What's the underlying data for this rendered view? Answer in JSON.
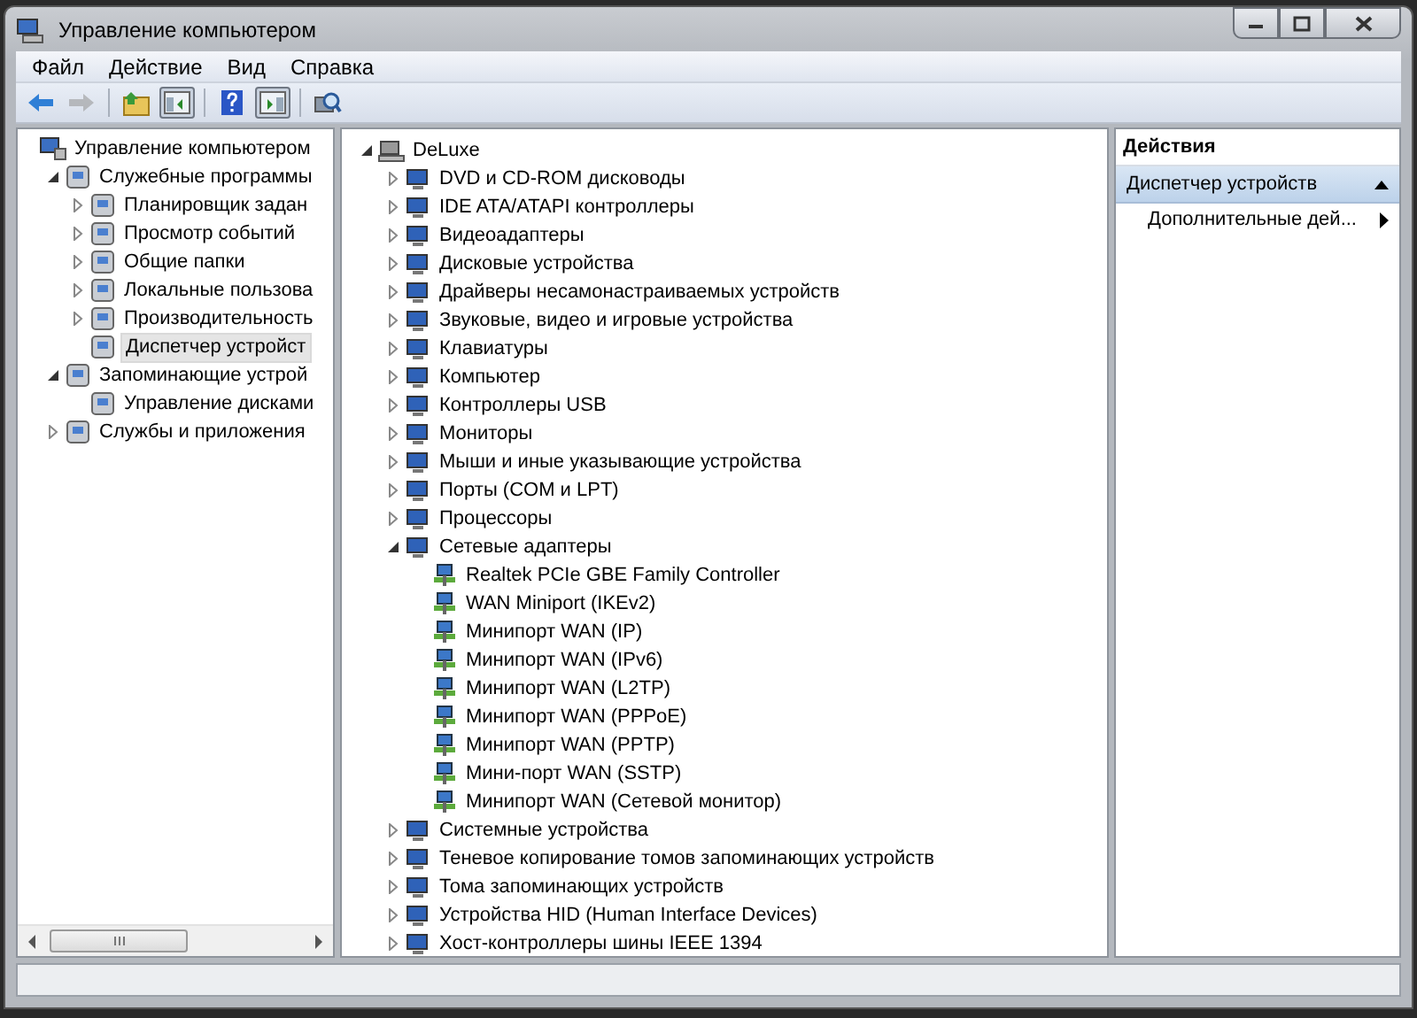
{
  "window": {
    "title": "Управление компьютером"
  },
  "menu": [
    "Файл",
    "Действие",
    "Вид",
    "Справка"
  ],
  "toolbar": [
    {
      "kind": "back",
      "disabled": false,
      "pressed": false
    },
    {
      "kind": "forward",
      "disabled": true,
      "pressed": false
    },
    {
      "kind": "sep"
    },
    {
      "kind": "up",
      "disabled": false,
      "pressed": false
    },
    {
      "kind": "tree",
      "disabled": false,
      "pressed": true
    },
    {
      "kind": "sep"
    },
    {
      "kind": "help",
      "disabled": false,
      "pressed": false
    },
    {
      "kind": "pane",
      "disabled": false,
      "pressed": true
    },
    {
      "kind": "sep"
    },
    {
      "kind": "scan",
      "disabled": false,
      "pressed": false
    }
  ],
  "left_tree": [
    {
      "label": "Управление компьютером",
      "kind": "root",
      "selected": false,
      "children": [
        {
          "label": "Служебные программы",
          "kind": "branch",
          "expanded": true,
          "selected": false,
          "children": [
            {
              "label": "Планировщик задан",
              "kind": "branch",
              "expanded": false,
              "selected": false
            },
            {
              "label": "Просмотр событий",
              "kind": "branch",
              "expanded": false,
              "selected": false
            },
            {
              "label": "Общие папки",
              "kind": "branch",
              "expanded": false,
              "selected": false
            },
            {
              "label": "Локальные пользова",
              "kind": "branch",
              "expanded": false,
              "selected": false
            },
            {
              "label": "Производительность",
              "kind": "branch",
              "expanded": false,
              "selected": false
            },
            {
              "label": "Диспетчер устройст",
              "kind": "leaf",
              "selected": true
            }
          ]
        },
        {
          "label": "Запоминающие устрой",
          "kind": "branch",
          "expanded": true,
          "selected": false,
          "children": [
            {
              "label": "Управление дисками",
              "kind": "leaf",
              "selected": false
            }
          ]
        },
        {
          "label": "Службы и приложения",
          "kind": "branch",
          "expanded": false,
          "selected": false
        }
      ]
    }
  ],
  "device_tree": [
    {
      "label": "DeLuxe",
      "kind": "branch",
      "expanded": true,
      "children": [
        {
          "label": "DVD и CD-ROM дисководы",
          "kind": "branch",
          "expanded": false
        },
        {
          "label": "IDE ATA/ATAPI контроллеры",
          "kind": "branch",
          "expanded": false
        },
        {
          "label": "Видеоадаптеры",
          "kind": "branch",
          "expanded": false
        },
        {
          "label": "Дисковые устройства",
          "kind": "branch",
          "expanded": false
        },
        {
          "label": "Драйверы несамонастраиваемых устройств",
          "kind": "branch",
          "expanded": false
        },
        {
          "label": "Звуковые, видео и игровые устройства",
          "kind": "branch",
          "expanded": false
        },
        {
          "label": "Клавиатуры",
          "kind": "branch",
          "expanded": false
        },
        {
          "label": "Компьютер",
          "kind": "branch",
          "expanded": false
        },
        {
          "label": "Контроллеры USB",
          "kind": "branch",
          "expanded": false
        },
        {
          "label": "Мониторы",
          "kind": "branch",
          "expanded": false
        },
        {
          "label": "Мыши и иные указывающие устройства",
          "kind": "branch",
          "expanded": false
        },
        {
          "label": "Порты (COM и LPT)",
          "kind": "branch",
          "expanded": false
        },
        {
          "label": "Процессоры",
          "kind": "branch",
          "expanded": false
        },
        {
          "label": "Сетевые адаптеры",
          "kind": "branch",
          "expanded": true,
          "children": [
            {
              "label": "Realtek PCIe GBE Family Controller",
              "kind": "leaf"
            },
            {
              "label": "WAN Miniport (IKEv2)",
              "kind": "leaf"
            },
            {
              "label": "Минипорт WAN (IP)",
              "kind": "leaf"
            },
            {
              "label": "Минипорт WAN (IPv6)",
              "kind": "leaf"
            },
            {
              "label": "Минипорт WAN (L2TP)",
              "kind": "leaf"
            },
            {
              "label": "Минипорт WAN (PPPoE)",
              "kind": "leaf"
            },
            {
              "label": "Минипорт WAN (PPTP)",
              "kind": "leaf"
            },
            {
              "label": "Мини-порт WAN (SSTP)",
              "kind": "leaf"
            },
            {
              "label": "Минипорт WAN (Сетевой монитор)",
              "kind": "leaf"
            }
          ]
        },
        {
          "label": "Системные устройства",
          "kind": "branch",
          "expanded": false
        },
        {
          "label": "Теневое копирование томов запоминающих устройств",
          "kind": "branch",
          "expanded": false
        },
        {
          "label": "Тома запоминающих устройств",
          "kind": "branch",
          "expanded": false
        },
        {
          "label": "Устройства HID (Human Interface Devices)",
          "kind": "branch",
          "expanded": false
        },
        {
          "label": "Хост-контроллеры шины IEEE 1394",
          "kind": "branch",
          "expanded": false
        }
      ]
    }
  ],
  "actions": {
    "header": "Действия",
    "section": {
      "title": "Диспетчер устройств",
      "expanded": true
    },
    "items": [
      "Дополнительные дей..."
    ]
  }
}
